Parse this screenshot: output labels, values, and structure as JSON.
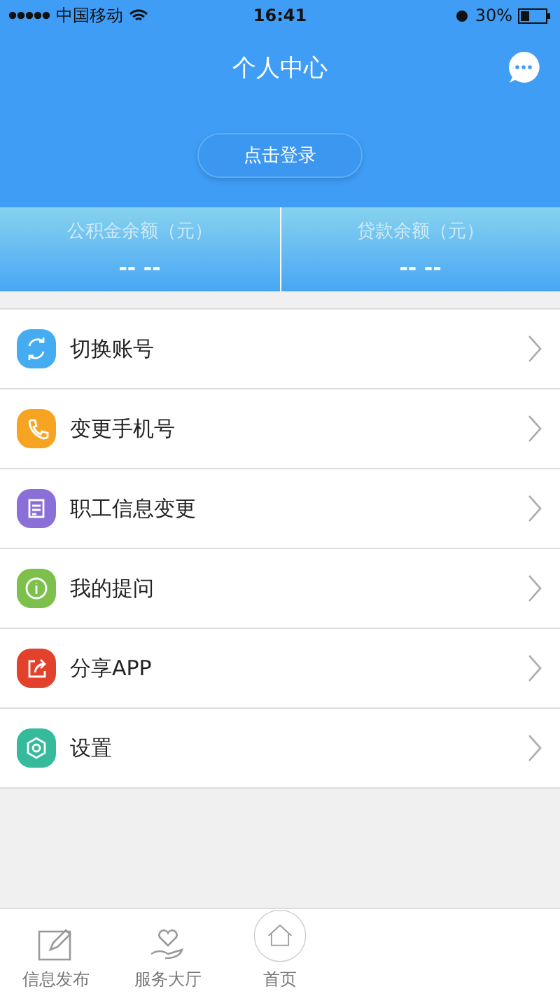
{
  "status_bar": {
    "carrier": "中国移动",
    "time": "16:41",
    "battery": "30%"
  },
  "header": {
    "title": "个人中心",
    "login_button": "点击登录"
  },
  "stats": [
    {
      "label": "公积金余额（元）",
      "value": "-- --"
    },
    {
      "label": "贷款余额（元）",
      "value": "-- --"
    }
  ],
  "menu": [
    {
      "label": "切换账号",
      "kind": "switch",
      "color": "#45acf2"
    },
    {
      "label": "变更手机号",
      "kind": "phone",
      "color": "#f7a422"
    },
    {
      "label": "职工信息变更",
      "kind": "form",
      "color": "#8b6fd8"
    },
    {
      "label": "我的提问",
      "kind": "info",
      "color": "#7dc04c"
    },
    {
      "label": "分享APP",
      "kind": "share",
      "color": "#e2412b"
    },
    {
      "label": "设置",
      "kind": "settings",
      "color": "#35ba9b"
    }
  ],
  "tab_bar": [
    {
      "label": "信息发布",
      "kind": "edit"
    },
    {
      "label": "服务大厅",
      "kind": "heart"
    },
    {
      "label": "首页",
      "kind": "home"
    }
  ]
}
